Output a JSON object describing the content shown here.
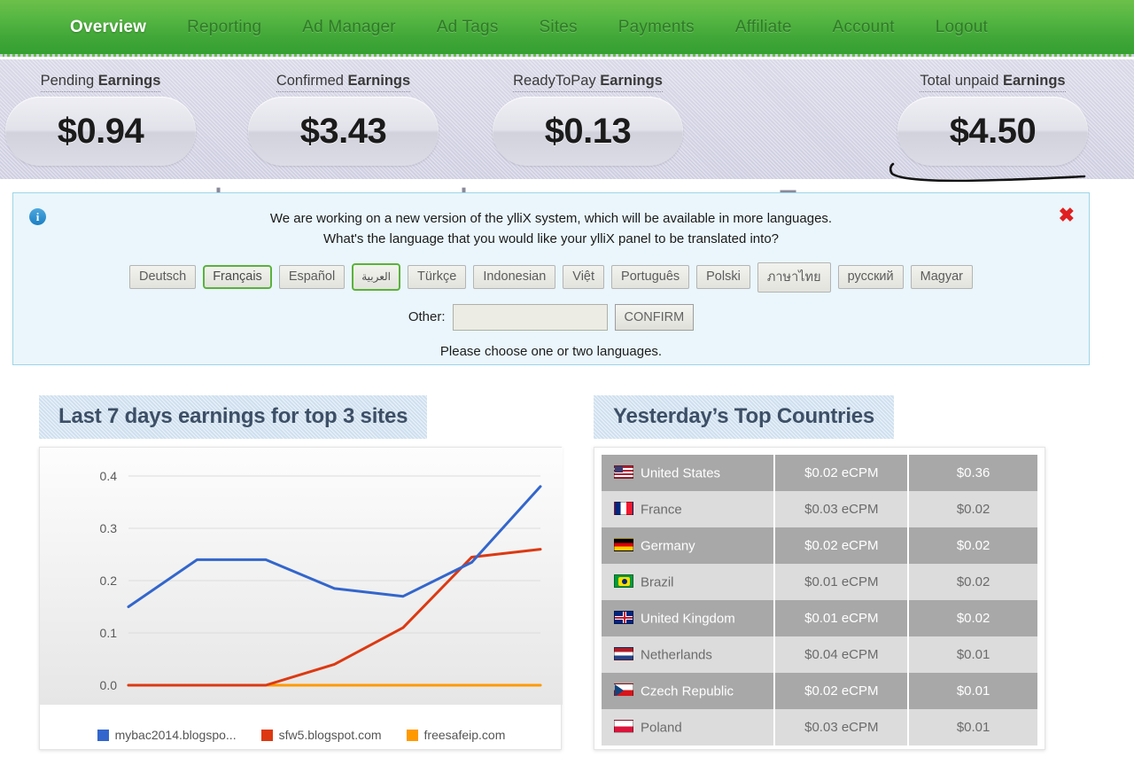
{
  "nav": {
    "items": [
      {
        "label": "Overview",
        "active": true
      },
      {
        "label": "Reporting",
        "active": false
      },
      {
        "label": "Ad Manager",
        "active": false
      },
      {
        "label": "Ad Tags",
        "active": false
      },
      {
        "label": "Sites",
        "active": false
      },
      {
        "label": "Payments",
        "active": false
      },
      {
        "label": "Affiliate",
        "active": false
      },
      {
        "label": "Account",
        "active": false
      },
      {
        "label": "Logout",
        "active": false
      }
    ]
  },
  "earnings": {
    "pending": {
      "label_light": "Pending ",
      "label_bold": "Earnings",
      "value": "$0.94"
    },
    "confirmed": {
      "label_light": "Confirmed ",
      "label_bold": "Earnings",
      "value": "$3.43"
    },
    "readytopay": {
      "label_light": "ReadyToPay ",
      "label_bold": "Earnings",
      "value": "$0.13"
    },
    "total": {
      "label_light": "Total unpaid ",
      "label_bold": "Earnings",
      "value": "$4.50"
    },
    "op_plus_1": "+",
    "op_plus_2": "+",
    "op_equals": "="
  },
  "notice": {
    "info_icon": "info-icon",
    "close_icon": "✖",
    "line1": "We are working on a new version of the ylliX system, which will be available in more languages.",
    "line2": "What's the language that you would like your ylliX panel to be translated into?",
    "languages": [
      {
        "label": "Deutsch",
        "selected": false
      },
      {
        "label": "Français",
        "selected": true
      },
      {
        "label": "Español",
        "selected": false
      },
      {
        "label": "العربية",
        "selected": true
      },
      {
        "label": "Türkçe",
        "selected": false
      },
      {
        "label": "Indonesian",
        "selected": false
      },
      {
        "label": "Việt",
        "selected": false
      },
      {
        "label": "Português",
        "selected": false
      },
      {
        "label": "Polski",
        "selected": false
      },
      {
        "label": "ภาษาไทย",
        "selected": false
      },
      {
        "label": "русский",
        "selected": false
      },
      {
        "label": "Magyar",
        "selected": false
      }
    ],
    "other_label": "Other:",
    "other_value": "",
    "other_placeholder": "",
    "confirm_label": "CONFIRM",
    "footer_note": "Please choose one or two languages."
  },
  "chart_panel": {
    "title": "Last 7 days earnings for top 3 sites"
  },
  "countries_panel": {
    "title": "Yesterday’s Top Countries",
    "rows": [
      {
        "country": "United States",
        "ecpm": "$0.02 eCPM",
        "earnings": "$0.36",
        "flag": "us"
      },
      {
        "country": "France",
        "ecpm": "$0.03 eCPM",
        "earnings": "$0.02",
        "flag": "fr"
      },
      {
        "country": "Germany",
        "ecpm": "$0.02 eCPM",
        "earnings": "$0.02",
        "flag": "de"
      },
      {
        "country": "Brazil",
        "ecpm": "$0.01 eCPM",
        "earnings": "$0.02",
        "flag": "br"
      },
      {
        "country": "United Kingdom",
        "ecpm": "$0.01 eCPM",
        "earnings": "$0.02",
        "flag": "gb"
      },
      {
        "country": "Netherlands",
        "ecpm": "$0.04 eCPM",
        "earnings": "$0.01",
        "flag": "nl"
      },
      {
        "country": "Czech Republic",
        "ecpm": "$0.02 eCPM",
        "earnings": "$0.01",
        "flag": "cz"
      },
      {
        "country": "Poland",
        "ecpm": "$0.03 eCPM",
        "earnings": "$0.01",
        "flag": "pl"
      }
    ]
  },
  "chart_data": {
    "type": "line",
    "title": "Last 7 days earnings for top 3 sites",
    "xlabel": "",
    "ylabel": "",
    "ylim": [
      0.0,
      0.4
    ],
    "yticks": [
      0.0,
      0.1,
      0.2,
      0.3,
      0.4
    ],
    "ytick_labels": [
      "0.0",
      "0.1",
      "0.2",
      "0.3",
      "0.4"
    ],
    "x": [
      1,
      2,
      3,
      4,
      5,
      6,
      7
    ],
    "grid": true,
    "legend_position": "bottom",
    "series": [
      {
        "name": "mybac2014.blogspo...",
        "color": "#3366cc",
        "values": [
          0.15,
          0.24,
          0.24,
          0.185,
          0.17,
          0.235,
          0.38
        ]
      },
      {
        "name": "sfw5.blogspot.com",
        "color": "#dc3912",
        "values": [
          0.0,
          0.0,
          0.0,
          0.04,
          0.11,
          0.245,
          0.26
        ]
      },
      {
        "name": "freesafeip.com",
        "color": "#ff9900",
        "values": [
          0.0,
          0.0,
          0.0,
          0.0,
          0.0,
          0.0,
          0.0
        ]
      }
    ]
  },
  "colors": {
    "nav_green": "#4fb03c",
    "banner_blue": "#eaf6fb",
    "panel_title_blue": "#cfe0ef",
    "selected_lang_green": "#5ab23c",
    "close_red": "#e02020",
    "series_blue": "#3366cc",
    "series_red": "#dc3912",
    "series_orange": "#ff9900"
  }
}
